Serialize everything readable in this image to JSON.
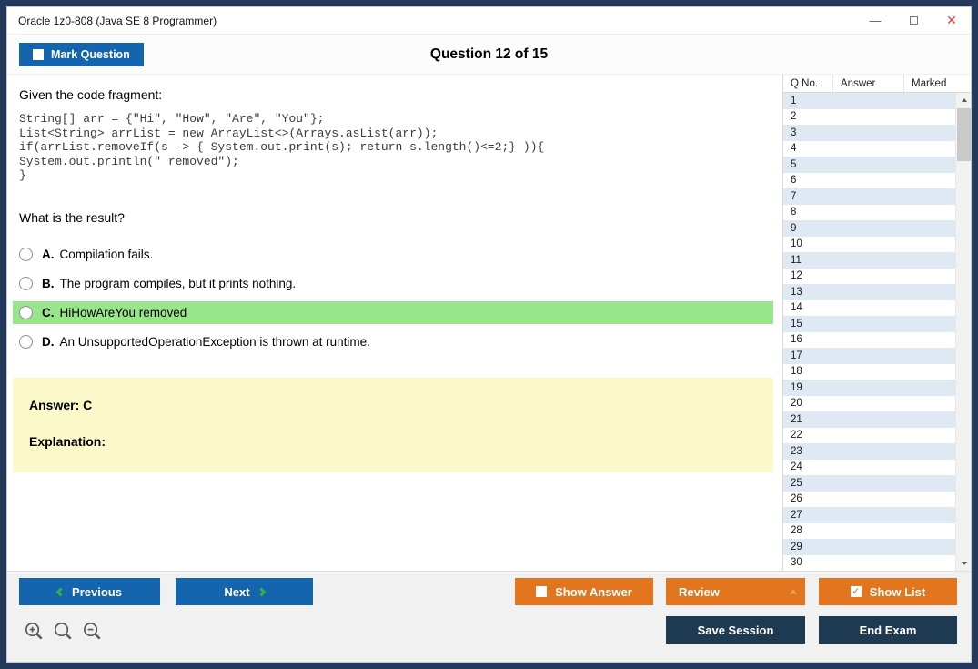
{
  "window": {
    "title": "Oracle 1z0-808 (Java SE 8 Programmer)"
  },
  "header": {
    "mark_question": "Mark Question",
    "question_counter": "Question 12 of 15"
  },
  "question": {
    "prompt": "Given the code fragment:",
    "code_lines": [
      "String[] arr = {\"Hi\", \"How\", \"Are\", \"You\"};",
      "List<String> arrList = new ArrayList<>(Arrays.asList(arr));",
      "if(arrList.removeIf(s -> { System.out.print(s); return s.length()<=2;} )){",
      "System.out.println(\" removed\");",
      "}"
    ],
    "question_text": "What is the result?",
    "options": [
      {
        "letter": "A.",
        "text": "Compilation fails.",
        "highlighted": false
      },
      {
        "letter": "B.",
        "text": "The program compiles, but it prints nothing.",
        "highlighted": false
      },
      {
        "letter": "C.",
        "text": "HiHowAreYou removed",
        "highlighted": true
      },
      {
        "letter": "D.",
        "text": "An UnsupportedOperationException is thrown at runtime.",
        "highlighted": false
      }
    ],
    "answer_label": "Answer: C",
    "explanation_label": "Explanation:"
  },
  "sidebar": {
    "columns": [
      "Q No.",
      "Answer",
      "Marked"
    ],
    "rows": [
      1,
      2,
      3,
      4,
      5,
      6,
      7,
      8,
      9,
      10,
      11,
      12,
      13,
      14,
      15,
      16,
      17,
      18,
      19,
      20,
      21,
      22,
      23,
      24,
      25,
      26,
      27,
      28,
      29,
      30
    ]
  },
  "footer": {
    "previous": "Previous",
    "next": "Next",
    "show_answer": "Show Answer",
    "review": "Review",
    "show_list": "Show List",
    "save_session": "Save Session",
    "end_exam": "End Exam"
  },
  "colors": {
    "accent_blue": "#1565AE",
    "accent_orange": "#E2751D",
    "dark_navy": "#1E3A52",
    "frame_navy": "#22395B",
    "highlight_green": "#98E58C",
    "answer_yellow": "#FBF8CA",
    "row_alt_blue": "#DEE9F4",
    "arrow_green": "#2FB344"
  }
}
